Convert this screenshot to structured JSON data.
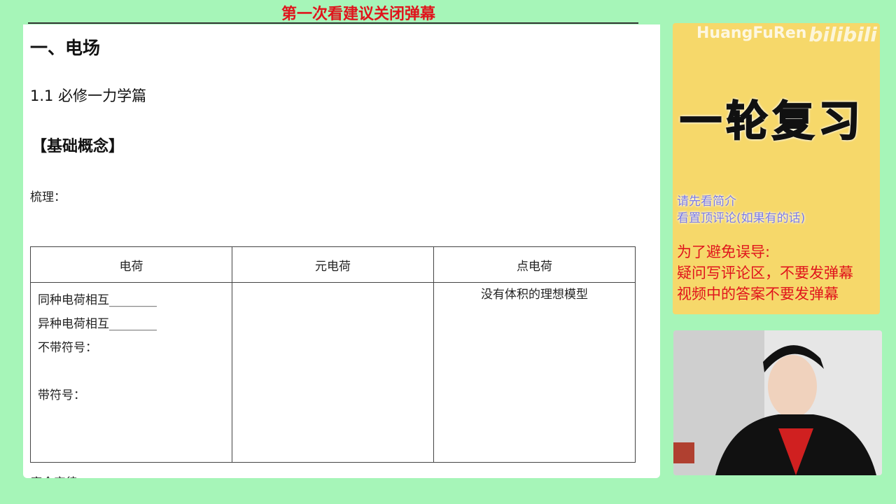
{
  "banner": "第一次看建议关闭弹幕",
  "doc": {
    "h1": "一、电场",
    "h2": "1.1 必修一力学篇",
    "h3": "【基础概念】",
    "label": "梳理：",
    "cut_text": "库仑定律",
    "table": {
      "headers": [
        "电荷",
        "元电荷",
        "点电荷"
      ],
      "col1": [
        "同种电荷相互________",
        "异种电荷相互________",
        "不带符号：",
        "",
        "带符号："
      ],
      "col3": [
        "没有体积的理想模型"
      ]
    }
  },
  "side": {
    "watermark": "HuangFuRen",
    "logo": "bilibili",
    "title": "一轮复习",
    "blue_lines": [
      "请先看简介",
      "看置顶评论(如果有的话)"
    ],
    "red_lines": [
      "为了避免误导:",
      "疑问写评论区，不要发弹幕",
      "视频中的答案不要发弹幕"
    ]
  }
}
